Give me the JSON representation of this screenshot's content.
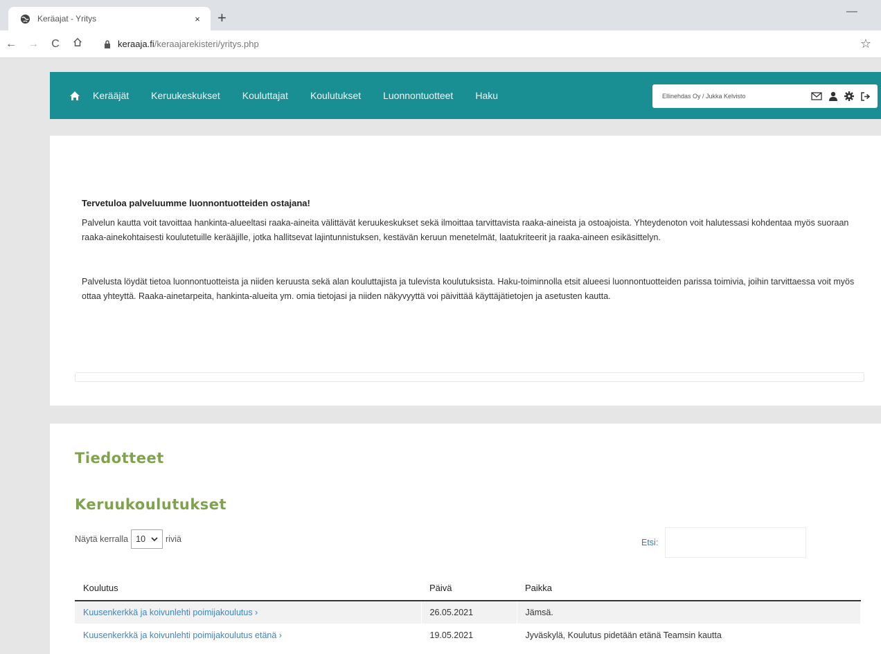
{
  "browser": {
    "tab_title": "Keräajat - Yritys",
    "tab_close": "×",
    "new_tab": "+",
    "minimize": "—",
    "back": "←",
    "forward": "→",
    "reload": "C",
    "url_host": "keraaja.fi",
    "url_path": "/keraajarekisteri/yritys.php",
    "bookmark": "☆"
  },
  "nav": {
    "links": [
      "Kerääjät",
      "Keruukeskukset",
      "Kouluttajat",
      "Koulutukset",
      "Luonnontuotteet",
      "Haku"
    ],
    "user_label": "Ellinehdas Oy / Jukka Kelvisto"
  },
  "welcome": {
    "title": "Tervetuloa palveluumme luonnontuotteiden ostajana!",
    "p1": "Palvelun kautta voit tavoittaa hankinta-alueeltasi raaka-aineita välittävät keruukeskukset sekä ilmoittaa tarvittavista raaka-aineista ja ostoajoista. Yhteydenoton voit halutessasi kohdentaa myös suoraan raaka-ainekohtaisesti koulutetuille kerääjille, jotka hallitsevat lajintunnistuksen, kestävän keruun menetelmät, laatukriteerit ja raaka-aineen esikäsittelyn.",
    "p2": "Palvelusta löydät tietoa luonnontuotteista ja niiden keruusta sekä alan kouluttajista ja tulevista koulutuksista. Haku-toiminnolla etsit alueesi luonnontuotteiden parissa toimivia, joihin tarvittaessa voit myös ottaa yhteyttä. Raaka-ainetarpeita, hankinta-alueita ym. omia tietojasi ja niiden näkyvyyttä voi päivittää käyttäjätietojen ja asetusten kautta."
  },
  "announcements": {
    "title": "Tiedotteet"
  },
  "trainings": {
    "title": "Keruukoulutukset",
    "show_prefix": "Näytä kerralla",
    "show_value": "10",
    "show_suffix": "riviä",
    "search_label": "Etsi:",
    "columns": [
      "Koulutus",
      "Päivä",
      "Paikka"
    ],
    "rows": [
      {
        "name": "Kuusenkerkkä ja koivunlehti poimijakoulutus ›",
        "date": "26.05.2021",
        "place": "Jämsä."
      },
      {
        "name": "Kuusenkerkkä ja koivunlehti poimijakoulutus etänä ›",
        "date": "19.05.2021",
        "place": "Jyväskylä, Koulutus pidetään etänä Teamsin kautta"
      }
    ]
  },
  "colors": {
    "nav_bg": "#1a8f93",
    "heading_green": "#7ea34a",
    "link_blue": "#3b86c6"
  }
}
